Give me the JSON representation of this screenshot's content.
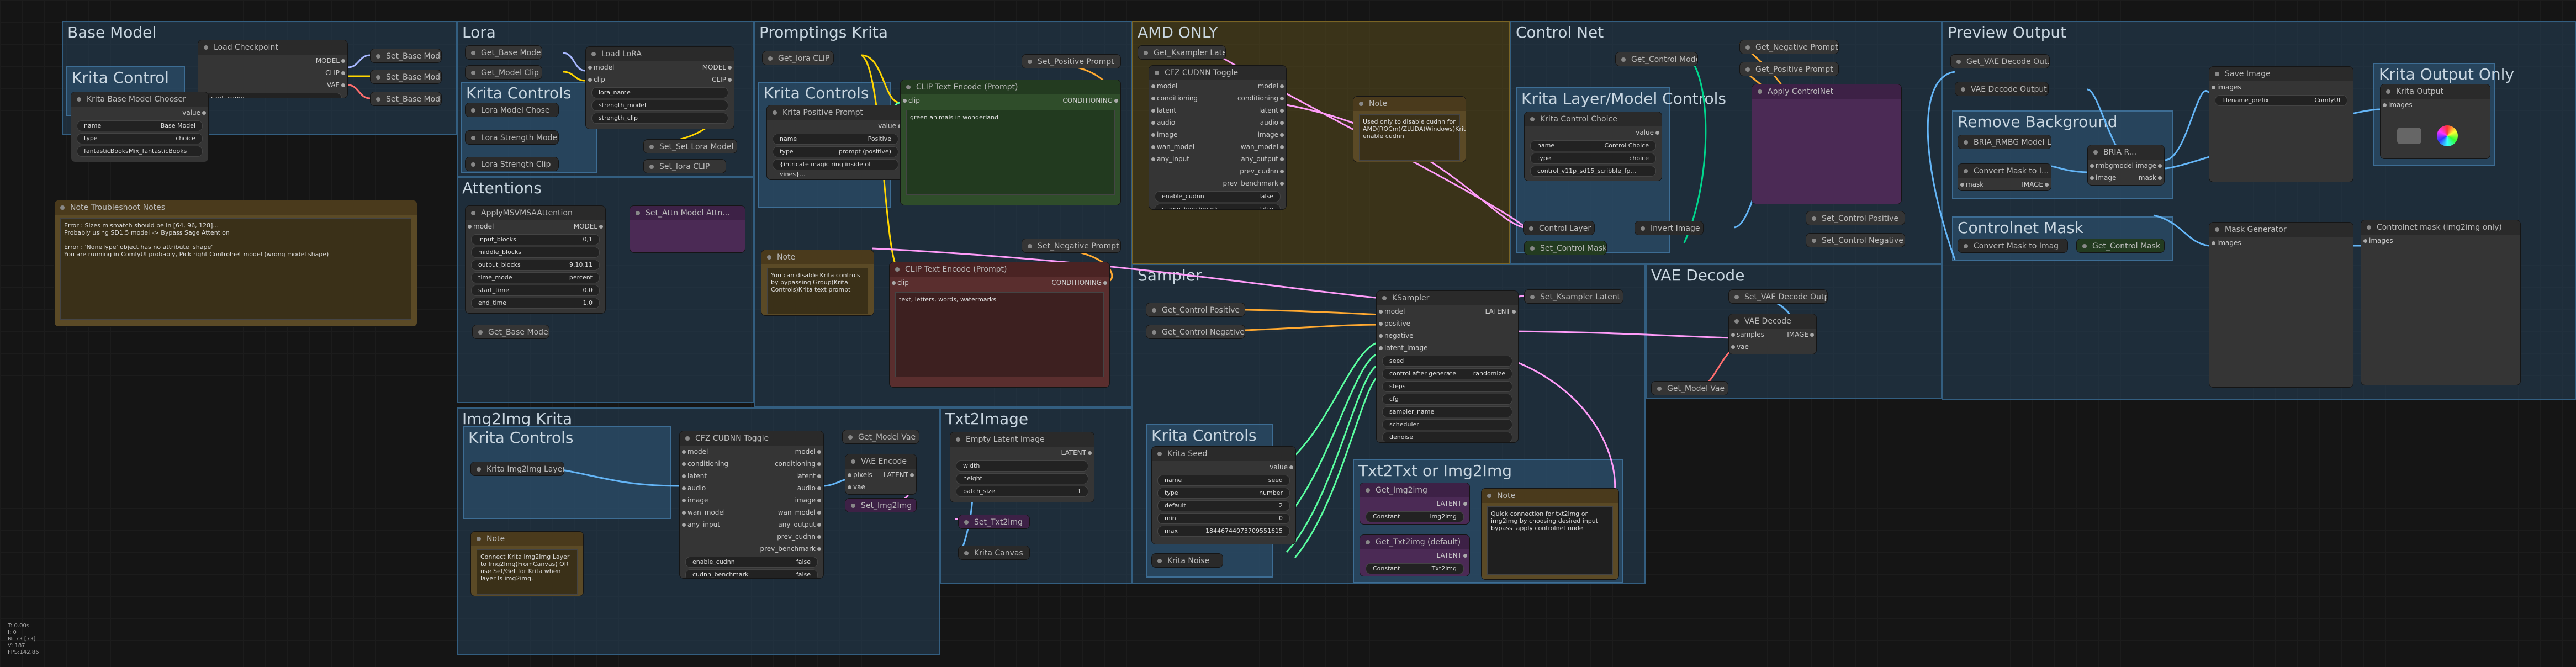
{
  "groups": {
    "base_model": "Base Model",
    "krita_control": "Krita Control",
    "lora": "Lora",
    "krita_controls": "Krita Controls",
    "promptings_krita": "Promptings Krita",
    "krita_controls2": "Krita Controls",
    "amd_only": "AMD ONLY",
    "control_net": "Control Net",
    "krita_layer_model_controls": "Krita Layer/Model Controls",
    "preview_output": "Preview Output",
    "remove_background": "Remove Background",
    "controlnet_mask": "Controlnet Mask",
    "krita_output_only": "Krita Output Only",
    "attentions": "Attentions",
    "sampler": "Sampler",
    "vae_decode": "VAE Decode",
    "img2img_krita": "Img2Img Krita",
    "img2img_controls": "Krita Controls",
    "txt2image": "Txt2Image",
    "sampler_controls": "Krita Controls",
    "txt2txt": "Txt2Txt or Img2Img"
  },
  "nodes": {
    "load_checkpoint": {
      "title": "Load Checkpoint",
      "outputs": [
        "MODEL",
        "CLIP",
        "VAE"
      ],
      "widget": "ckpt_name"
    },
    "set_base_model": "Set_Base Model",
    "set_base_model_clip": "Set_Base Model Clip",
    "set_base_model_vae": "Set_Base Model Vae",
    "krita_base_model_chooser": {
      "title": "Krita Base Model Chooser",
      "out": "value",
      "name_label": "name",
      "name_value": "Base Model",
      "type_label": "type",
      "type_value": "choice",
      "default_value": "fantasticBooksMix_fantasticBooks"
    },
    "note_troubleshoot": {
      "title": "Note Troubleshoot Notes",
      "text": "Error : Sizes mismatch should be in [64, 96, 128]...\nProbably using SD1.5 model -> Bypass Sage Attention\n\nError : 'NoneType' object has no attribute 'shape'\nYou are running in ComfyUI probably, Pick right Controlnet model (wrong model shape)"
    },
    "get_base_model": "Get_Base Model",
    "get_model_clip": "Get_Model Clip",
    "load_lora": {
      "title": "Load LoRA",
      "in": [
        "model",
        "clip"
      ],
      "outputs": [
        "MODEL",
        "CLIP"
      ],
      "widgets": [
        "lora_name",
        "strength_model",
        "strength_clip"
      ]
    },
    "lora_model_chose": "Lora Model Chose",
    "lora_strength_model": "Lora Strength Model",
    "lora_strength_clip": "Lora Strength Clip",
    "set_set_lora_model": "Set_Set Lora Model",
    "set_lora_clip": "Set_lora CLIP",
    "get_lora_clip": "Get_lora CLIP",
    "set_positive_prompt": "Set_Positive Prompt",
    "krita_positive_prompt": {
      "title": "Krita Positive Prompt",
      "out": "value",
      "name_value": "Positive",
      "type_value": "prompt (positive)",
      "default_value": "{intricate magic ring inside of vines}..."
    },
    "clip_text_encode_pos": {
      "title": "CLIP Text Encode (Prompt)",
      "in": "clip",
      "out": "CONDITIONING",
      "text": "green animals in wonderland"
    },
    "note_prompt": {
      "title": "Note",
      "text": "You can disable Krita controls by bypassing Group(Krita Controls)Krita text prompt"
    },
    "set_negative_prompt": "Set_Negative Prompt",
    "clip_text_encode_neg": {
      "title": "CLIP Text Encode (Prompt)",
      "in": "clip",
      "out": "CONDITIONING",
      "text": "text, letters, words, watermarks"
    },
    "get_ksampler_latent": "Get_Ksampler Latent",
    "cfz_cudnn_toggle": {
      "title": "CFZ CUDNN Toggle",
      "in": [
        "model",
        "conditioning",
        "latent",
        "audio",
        "image",
        "wan_model",
        "any_input"
      ],
      "outputs": [
        "model",
        "conditioning",
        "latent",
        "audio",
        "image",
        "wan_model",
        "any_output",
        "prev_cudnn",
        "prev_benchmark"
      ],
      "w1_label": "enable_cudnn",
      "w1_value": "false",
      "w2_label": "cudnn_benchmark",
      "w2_value": "false"
    },
    "note_amd": {
      "title": "Note",
      "text": "Used only to disable cudnn for AMD(ROCm)/ZLUDA(Windows)Krita/Comfyui enable cudnn"
    },
    "get_control_model": "Get_Control Model",
    "get_negative_prompt": "Get_Negative Prompt",
    "get_positive_prompt": "Get_Positive Prompt",
    "krita_control_choice": {
      "title": "Krita Control Choice",
      "name_value": "Control Choice",
      "type_value": "choice",
      "default_value": "control_v11p_sd15_scribble_fp..."
    },
    "controlnet_purple": "Apply ControlNet",
    "control_layer": "Control Layer 1",
    "invert_image": "Invert Image",
    "set_control_mask": "Set_Control Mask",
    "set_control_positive": "Set_Control Positive",
    "set_control_negative": "Set_Control Negative",
    "get_vae_decode_output": "Get_VAE Decode Out...",
    "vae_decode_output": "VAE Decode Output",
    "save_image": {
      "title": "Save Image",
      "in": "images",
      "prefix_label": "filename_prefix",
      "prefix_value": "ComfyUI"
    },
    "krita_output": {
      "title": "Krita Output",
      "in": "images"
    },
    "bria_rmbg_model_loader": "BRIA_RMBG Model Lo...",
    "bria_rmbg": {
      "title": "BRIA R...",
      "in": [
        "rmbgmodel",
        "image"
      ],
      "outputs": [
        "image",
        "mask"
      ]
    },
    "convert_mask_to_image1": "Convert Mask to I...",
    "convert_mask_to_image2": "Convert Mask to Imag",
    "get_control_mask": "Get_Control Mask",
    "mask_generator": {
      "title": "Mask Generator",
      "in": "images"
    },
    "controlnet_mask_only": {
      "title": "Controlnet mask (img2img only)",
      "in": "images"
    },
    "apply_attention": {
      "title": "ApplyMSVMSAAttention",
      "in": "model",
      "out": "MODEL",
      "w": [
        [
          "input_blocks",
          "0,1"
        ],
        [
          "middle_blocks",
          ""
        ],
        [
          "output_blocks",
          "9,10,11"
        ],
        [
          "time_mode",
          "percent"
        ],
        [
          "start_time",
          "0.0"
        ],
        [
          "end_time",
          "1.0"
        ]
      ]
    },
    "set_attn_model": "Set_Attn Model Attn...",
    "get_base_model2": "Get_Base Model",
    "ksampler": {
      "title": "KSampler",
      "in": [
        "model",
        "positive",
        "negative",
        "latent_image"
      ],
      "out": "LATENT",
      "w": [
        "seed",
        "control after generate",
        "steps",
        "cfg",
        "sampler_name",
        "scheduler",
        "denoise"
      ],
      "cag_value": "randomize"
    },
    "get_control_positive": "Get_Control Positive",
    "get_control_negative": "Get_Control Negative",
    "set_ksampler_latent": "Set_Ksampler Latent",
    "set_vae_decode_outputs": "Set_VAE Decode Outpu",
    "vae_decode": {
      "title": "VAE Decode",
      "in": [
        "samples",
        "vae"
      ],
      "out": "IMAGE"
    },
    "get_model_vae": "Get_Model Vae",
    "krita_img2img_layer": "Krita Img2Img Layer",
    "cfz_cudnn_toggle2": {
      "title": "CFZ CUDNN Toggle"
    },
    "get_model_vae2": "Get_Model Vae",
    "vae_encode": {
      "title": "VAE Encode",
      "in": [
        "pixels",
        "vae"
      ],
      "out": "LATENT"
    },
    "set_img2img": "Set_Img2Img",
    "note_img2img": {
      "title": "Note",
      "text": "Connect Krita Img2Img Layer to Img2Img(FromCanvas) OR use Set/Get for Krita when layer Is img2img."
    },
    "empty_latent": {
      "title": "Empty Latent Image",
      "out": "LATENT",
      "w": [
        [
          "width",
          ""
        ],
        [
          "height",
          ""
        ],
        [
          "batch_size",
          "1"
        ]
      ]
    },
    "set_txt2img": "Set_Txt2Img",
    "krita_canvas": "Krita Canvas",
    "krita_seed": {
      "title": "Krita Seed",
      "out": "value",
      "name_value": "seed",
      "type_value": "number",
      "default_value": "2",
      "min_value": "0",
      "max_value": "18446744073709551615"
    },
    "krita_noise": "Krita Noise",
    "get_img2img": {
      "title": "Get_Img2img",
      "out": "LATENT",
      "const_label": "Constant",
      "const_value": "img2img"
    },
    "get_txt2img": {
      "title": "Get_Txt2img (default)",
      "out": "LATENT",
      "const_label": "Constant",
      "const_value": "Txt2img"
    },
    "note_txt": {
      "title": "Note",
      "text": "Quick connection for txt2img or img2img by choosing desired input bypass  apply controlnet node"
    }
  },
  "stats": "T: 0.00s\nI: 0\nN: 73 [73]\nV: 187\nFPS:142.86"
}
